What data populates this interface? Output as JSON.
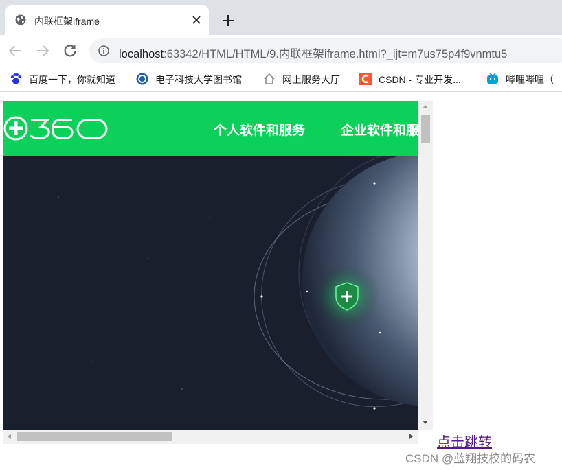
{
  "browser": {
    "tab": {
      "title": "内联框架iframe",
      "close_icon": "close-icon"
    },
    "new_tab_icon": "plus-icon",
    "toolbar": {
      "back_icon": "arrow-left-icon",
      "forward_icon": "arrow-right-icon",
      "reload_icon": "reload-icon",
      "url_host": "localhost",
      "url_rest": ":63342/HTML/HTML/9.内联框架iframe.html?_ijt=m7us75p4f9vnmtu5"
    },
    "bookmarks": [
      {
        "label": "百度一下，你就知道",
        "icon": "baidu-paw-icon"
      },
      {
        "label": "电子科技大学图书馆",
        "icon": "university-seal-icon"
      },
      {
        "label": "网上服务大厅",
        "icon": "house-icon"
      },
      {
        "label": "CSDN - 专业开发...",
        "icon": "csdn-icon"
      },
      {
        "label": "哔哩哔哩（",
        "icon": "bilibili-tv-icon"
      }
    ]
  },
  "iframe_content": {
    "logo_text": "360",
    "nav": [
      "个人软件和服务",
      "企业软件和服务"
    ],
    "colors": {
      "brand_green": "#0bd15a",
      "hero_bg": "#1a1f2e"
    }
  },
  "page": {
    "link_label": "点击跳转"
  },
  "watermark": "CSDN @蓝翔技校的码农"
}
